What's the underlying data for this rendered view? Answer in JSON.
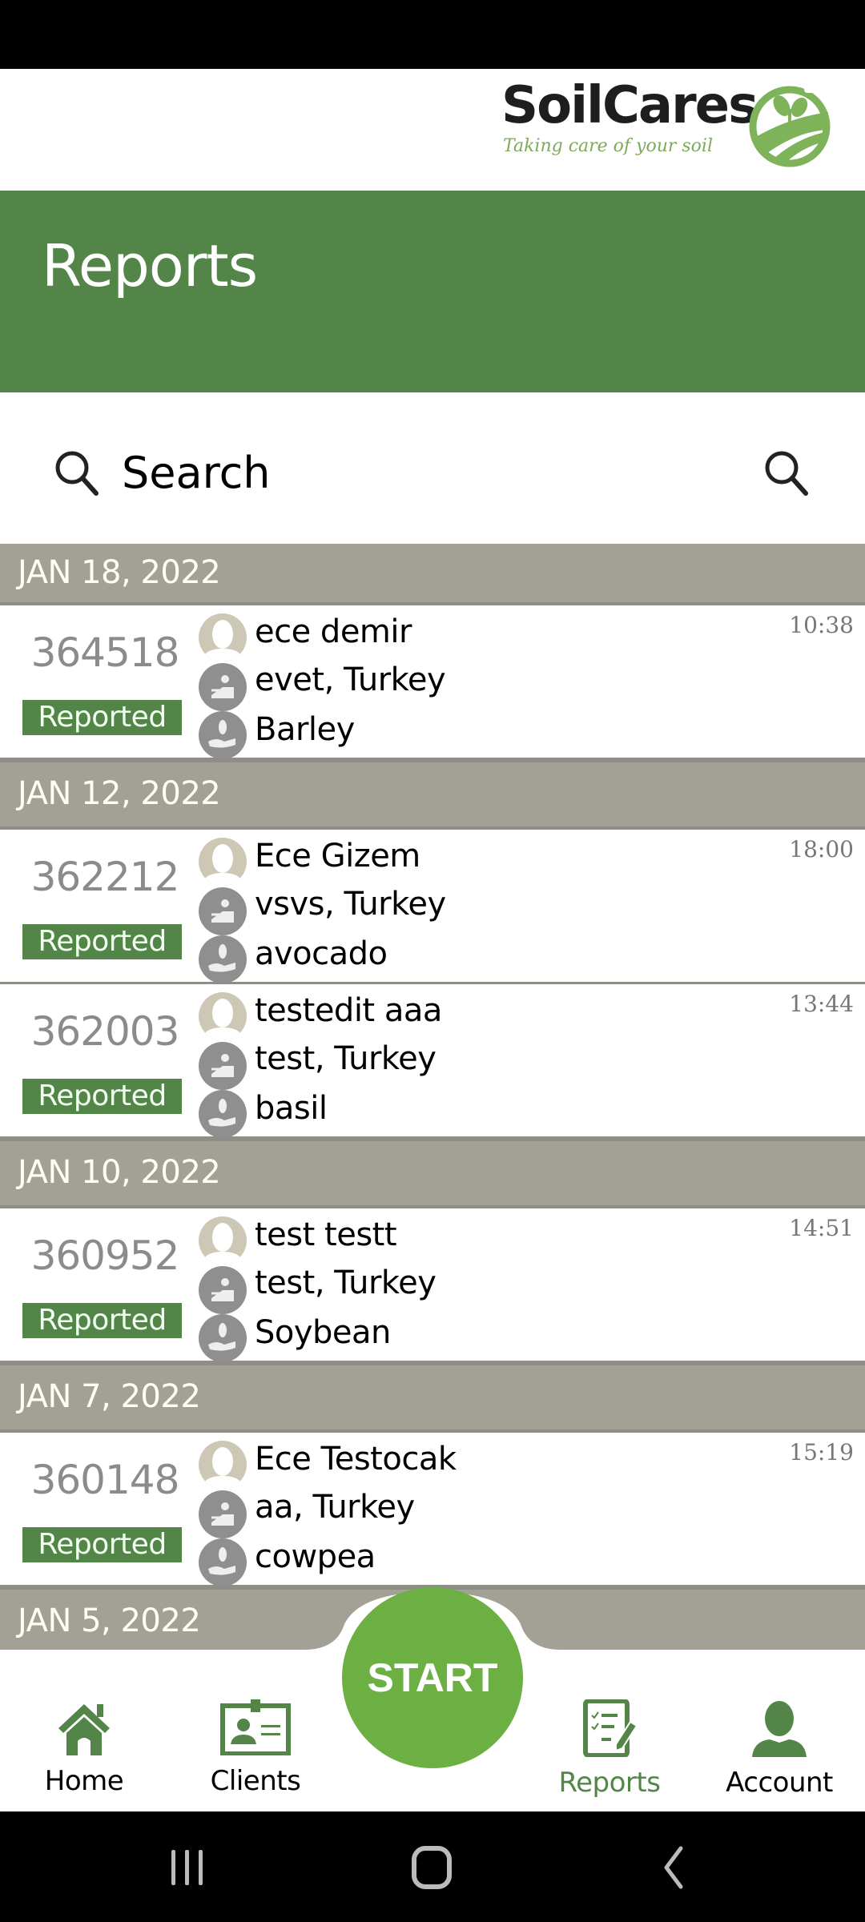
{
  "brand": {
    "name": "SoilCares",
    "tagline": "Taking care of your soil"
  },
  "header": {
    "title": "Reports"
  },
  "search": {
    "placeholder": "Search",
    "value": ""
  },
  "groups": [
    {
      "date": "JAN 18, 2022",
      "reports": [
        {
          "id": "364518",
          "status": "Reported",
          "client": "ece demir",
          "location": "evet, Turkey",
          "crop": "Barley",
          "time": "10:38"
        }
      ]
    },
    {
      "date": "JAN 12, 2022",
      "reports": [
        {
          "id": "362212",
          "status": "Reported",
          "client": "Ece Gizem",
          "location": "vsvs, Turkey",
          "crop": "avocado",
          "time": "18:00"
        },
        {
          "id": "362003",
          "status": "Reported",
          "client": "testedit aaa",
          "location": "test, Turkey",
          "crop": "basil",
          "time": "13:44"
        }
      ]
    },
    {
      "date": "JAN 10, 2022",
      "reports": [
        {
          "id": "360952",
          "status": "Reported",
          "client": "test testt",
          "location": "test, Turkey",
          "crop": "Soybean",
          "time": "14:51"
        }
      ]
    },
    {
      "date": "JAN 7, 2022",
      "reports": [
        {
          "id": "360148",
          "status": "Reported",
          "client": "Ece Testocak",
          "location": "aa, Turkey",
          "crop": "cowpea",
          "time": "15:19"
        }
      ]
    },
    {
      "date": "JAN 5, 2022",
      "reports": []
    }
  ],
  "start_button": {
    "label": "START"
  },
  "nav": {
    "items": [
      {
        "label": "Home",
        "icon": "home-icon",
        "active": false
      },
      {
        "label": "Clients",
        "icon": "id-card-icon",
        "active": false
      },
      {
        "label": "Reports",
        "icon": "checklist-edit-icon",
        "active": true
      },
      {
        "label": "Account",
        "icon": "person-icon",
        "active": false
      }
    ]
  },
  "colors": {
    "primary_green": "#548548",
    "start_green": "#6cb043",
    "date_header_bg": "#a3a196",
    "avatar_beige": "#cdc8b5"
  }
}
